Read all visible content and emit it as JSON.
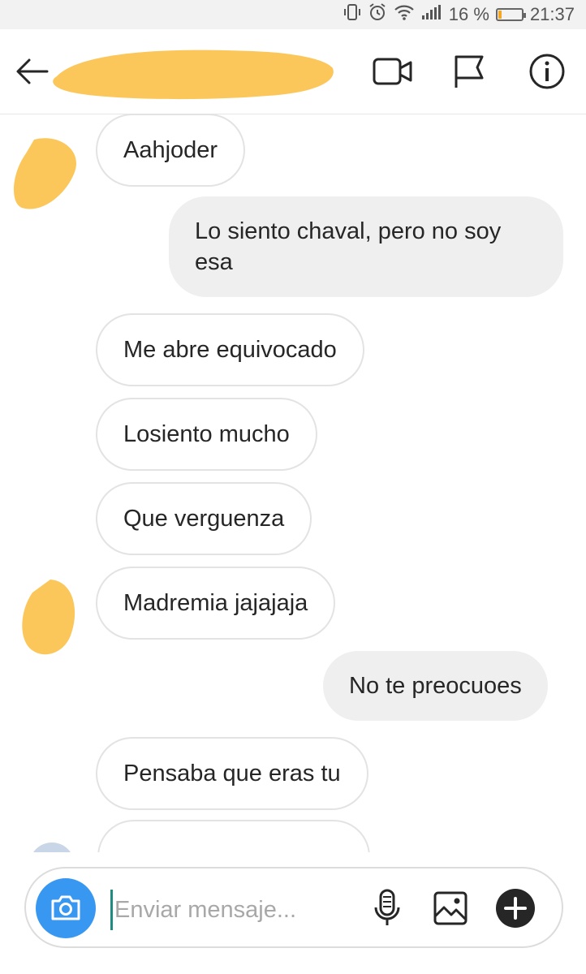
{
  "status_bar": {
    "battery_text": "16 %",
    "battery_level": 0.16,
    "time": "21:37",
    "icons": [
      "vibrate-icon",
      "alarm-icon",
      "wifi-icon",
      "signal-icon",
      "battery-icon"
    ]
  },
  "header": {
    "back_icon": "arrow-left-icon",
    "video_icon": "video-camera-icon",
    "flag_icon": "flag-icon",
    "info_icon": "info-icon"
  },
  "messages": [
    {
      "direction": "in",
      "text": "Aahjoder"
    },
    {
      "direction": "out",
      "text_line1": "Lo siento chaval, pero no soy",
      "text_line2": "esa"
    },
    {
      "direction": "in",
      "text": "Me abre equivocado"
    },
    {
      "direction": "in",
      "text": "Losiento mucho"
    },
    {
      "direction": "in",
      "text": "Que verguenza"
    },
    {
      "direction": "in",
      "text": "Madremia jajajaja"
    },
    {
      "direction": "out",
      "text": "No te preocuoes"
    },
    {
      "direction": "in",
      "text": "Pensaba que eras tu"
    }
  ],
  "composer": {
    "placeholder": "Enviar mensaje...",
    "value": "",
    "camera_icon": "camera-icon",
    "mic_icon": "microphone-icon",
    "gallery_icon": "image-icon",
    "plus_icon": "plus-icon"
  },
  "colors": {
    "accent": "#3897f0",
    "redaction": "#fbc75a",
    "outgoing_bubble": "#efefef",
    "incoming_border": "#e3e3e3"
  }
}
